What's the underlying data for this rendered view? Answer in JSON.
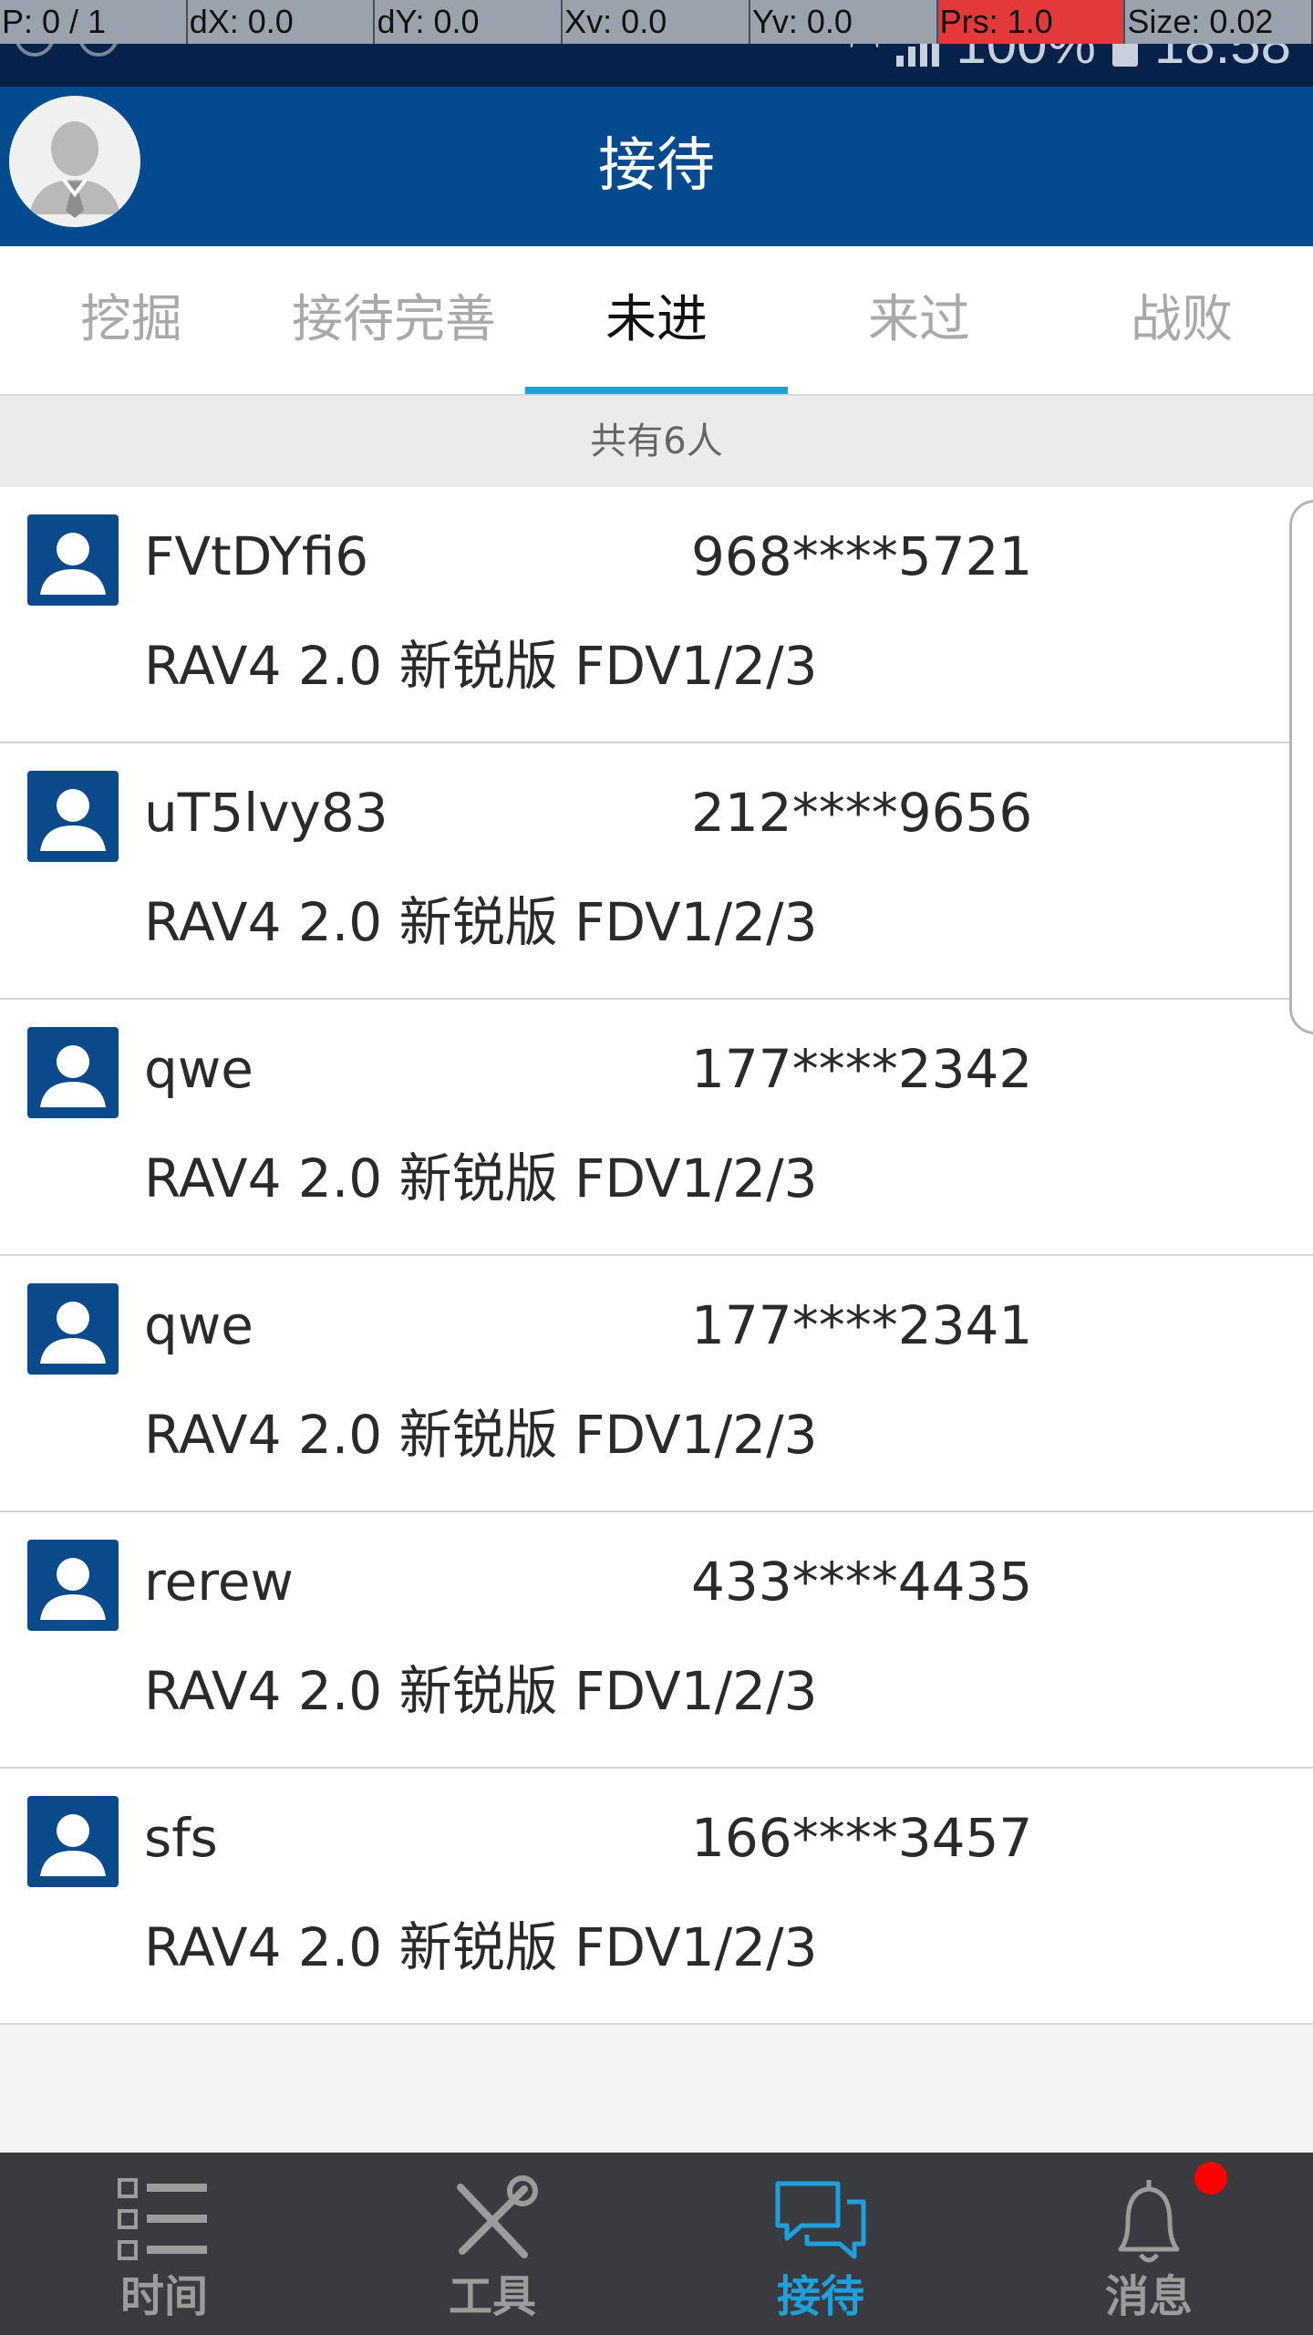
{
  "debug": [
    "P: 0 / 1",
    "dX: 0.0",
    "dY: 0.0",
    "Xv: 0.0",
    "Yv: 0.0",
    "Prs: 1.0",
    "Size: 0.02"
  ],
  "status": {
    "battery": "100%",
    "time": "18:58"
  },
  "header": {
    "title": "接待"
  },
  "tabs": [
    {
      "label": "挖掘",
      "active": false
    },
    {
      "label": "接待完善",
      "active": false
    },
    {
      "label": "未进",
      "active": true
    },
    {
      "label": "来过",
      "active": false
    },
    {
      "label": "战败",
      "active": false
    }
  ],
  "count_text": "共有6人",
  "customers": [
    {
      "name": "FVtDYfi6",
      "phone": "968****5721",
      "car": "RAV4 2.0 新锐版 FDV1/2/3"
    },
    {
      "name": "uT5lvy83",
      "phone": "212****9656",
      "car": "RAV4 2.0 新锐版 FDV1/2/3"
    },
    {
      "name": "qwe",
      "phone": "177****2342",
      "car": "RAV4 2.0 新锐版 FDV1/2/3"
    },
    {
      "name": "qwe",
      "phone": "177****2341",
      "car": "RAV4 2.0 新锐版 FDV1/2/3"
    },
    {
      "name": "rerew",
      "phone": "433****4435",
      "car": "RAV4 2.0 新锐版 FDV1/2/3"
    },
    {
      "name": "sfs",
      "phone": "166****3457",
      "car": "RAV4 2.0 新锐版 FDV1/2/3"
    }
  ],
  "nav": [
    {
      "label": "时间",
      "icon": "checklist-icon",
      "active": false
    },
    {
      "label": "工具",
      "icon": "tools-icon",
      "active": false
    },
    {
      "label": "接待",
      "icon": "chat-icon",
      "active": true
    },
    {
      "label": "消息",
      "icon": "bell-icon",
      "active": false,
      "badge": true
    }
  ],
  "colors": {
    "header": "#044a8f",
    "accent": "#1ea1d9",
    "nav_bg": "#3a3b40",
    "badge": "#ff0000"
  }
}
